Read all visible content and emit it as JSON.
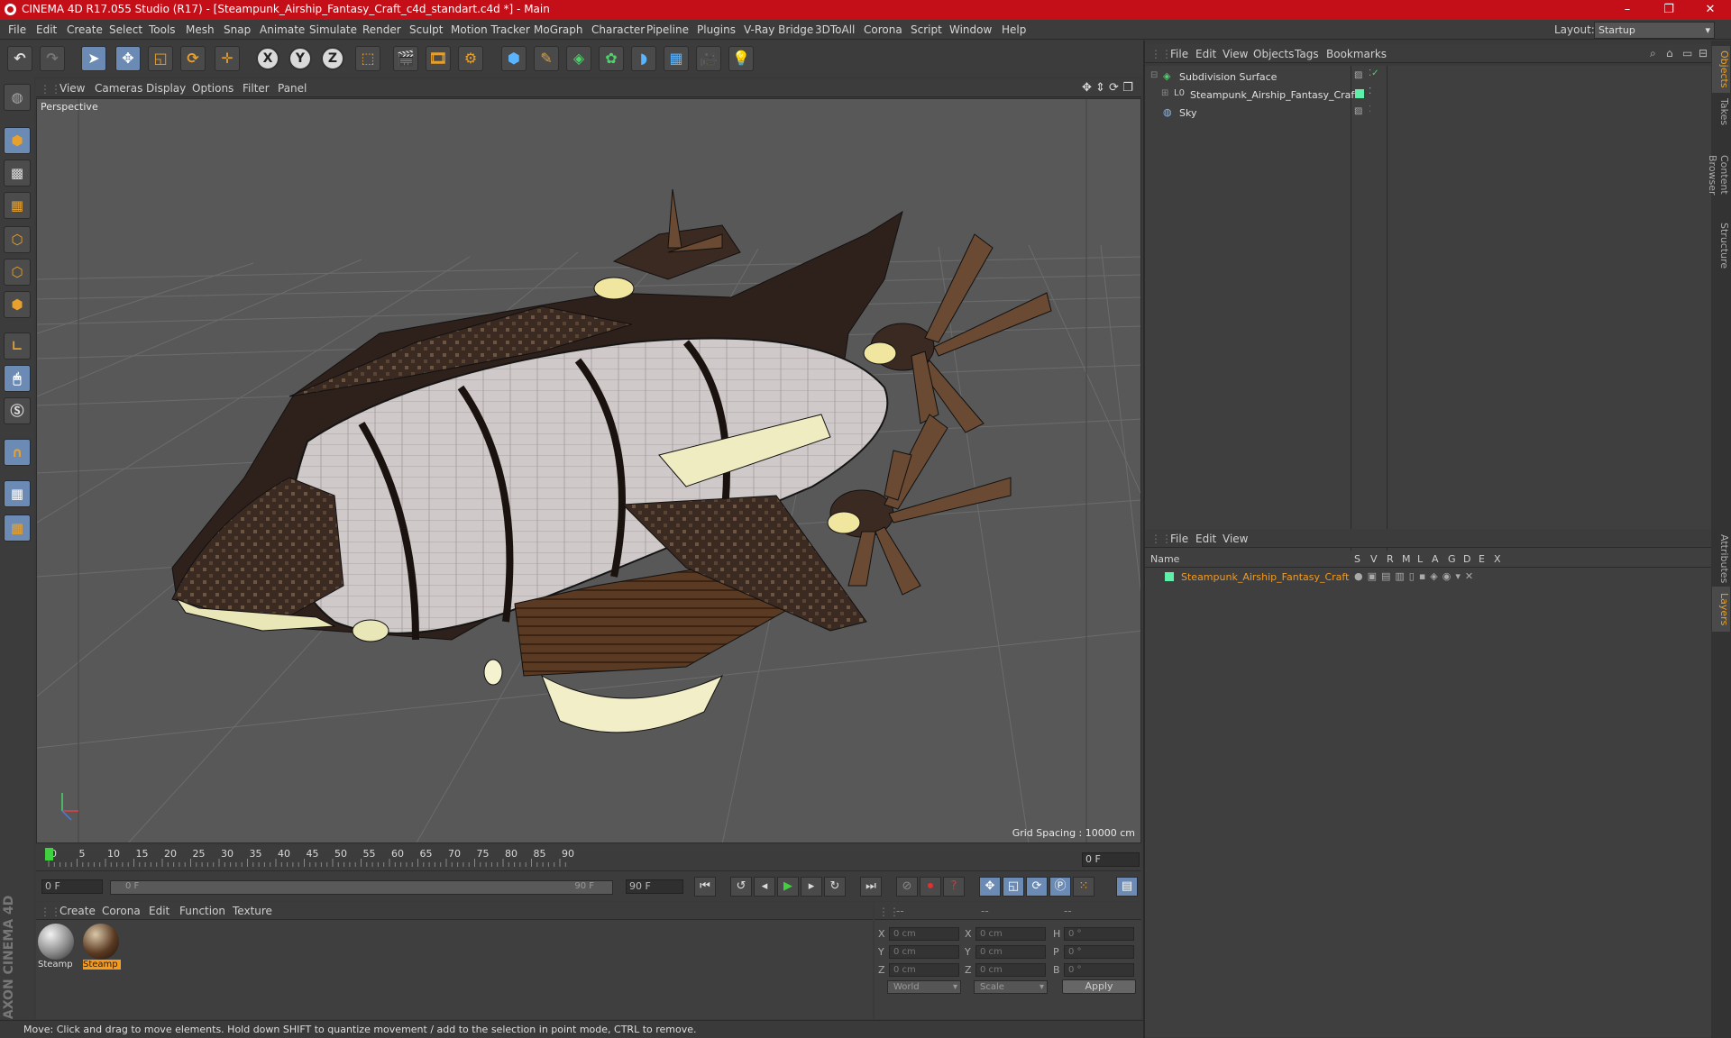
{
  "window": {
    "title": "CINEMA 4D R17.055 Studio (R17) - [Steampunk_Airship_Fantasy_Craft_c4d_standart.c4d *] - Main",
    "controls": [
      "–",
      "❐",
      "✕"
    ]
  },
  "menubar": {
    "items": [
      "File",
      "Edit",
      "Create",
      "Select",
      "Tools",
      "Mesh",
      "Snap",
      "Animate",
      "Simulate",
      "Render",
      "Sculpt",
      "Motion Tracker",
      "MoGraph",
      "Character",
      "Pipeline",
      "Plugins",
      "V-Ray Bridge",
      "3DToAll",
      "Corona",
      "Script",
      "Window",
      "Help"
    ],
    "layout_label": "Layout:",
    "layout_value": "Startup"
  },
  "toolbar": {
    "axis_x": "X",
    "axis_y": "Y",
    "axis_z": "Z"
  },
  "viewport": {
    "menu": [
      "View",
      "Cameras",
      "Display",
      "Options",
      "Filter",
      "Panel"
    ],
    "camera_label": "Perspective",
    "grid_spacing": "Grid Spacing : 10000 cm"
  },
  "timeline": {
    "ticks": [
      "0",
      "5",
      "10",
      "15",
      "20",
      "25",
      "30",
      "35",
      "40",
      "45",
      "50",
      "55",
      "60",
      "65",
      "70",
      "75",
      "80",
      "85",
      "90"
    ],
    "current_frame_right": "0 F",
    "start_field": "0 F",
    "slider_left": "0 F",
    "slider_right": "90 F",
    "end_field": "90 F"
  },
  "material_manager": {
    "menu": [
      "Create",
      "Corona",
      "Edit",
      "Function",
      "Texture"
    ],
    "materials": [
      {
        "label": "Steamp",
        "selected": false
      },
      {
        "label": "Steamp",
        "selected": true
      }
    ]
  },
  "coordinates": {
    "header": [
      "--",
      "--",
      "--"
    ],
    "rows": [
      {
        "a": "X",
        "av": "0 cm",
        "b": "X",
        "bv": "0 cm",
        "c": "H",
        "cv": "0 °"
      },
      {
        "a": "Y",
        "av": "0 cm",
        "b": "Y",
        "bv": "0 cm",
        "c": "P",
        "cv": "0 °"
      },
      {
        "a": "Z",
        "av": "0 cm",
        "b": "Z",
        "bv": "0 cm",
        "c": "B",
        "cv": "0 °"
      }
    ],
    "mode_world": "World",
    "mode_scale": "Scale",
    "apply": "Apply"
  },
  "status": "Move: Click and drag to move elements. Hold down SHIFT to quantize movement / add to the selection in point mode, CTRL to remove.",
  "object_manager": {
    "menu": [
      "File",
      "Edit",
      "View",
      "Objects",
      "Tags",
      "Bookmarks"
    ],
    "objects": [
      {
        "name": "Subdivision Surface"
      },
      {
        "name": "Steampunk_Airship_Fantasy_Craft"
      },
      {
        "name": "Sky"
      }
    ]
  },
  "layer_manager": {
    "menu": [
      "File",
      "Edit",
      "View"
    ],
    "columns": [
      "Name",
      "S",
      "V",
      "R",
      "M",
      "L",
      "A",
      "G",
      "D",
      "E",
      "X"
    ],
    "layers": [
      {
        "name": "Steampunk_Airship_Fantasy_Craft"
      }
    ]
  },
  "side_tabs": [
    "Objects",
    "Takes",
    "Content Browser",
    "Structure",
    "Attributes",
    "Layers"
  ],
  "branding": "MAXON CINEMA 4D",
  "colors": {
    "accent": "#f39a1f",
    "selected_blue": "#6b8bb5",
    "title_red": "#c40e18"
  }
}
